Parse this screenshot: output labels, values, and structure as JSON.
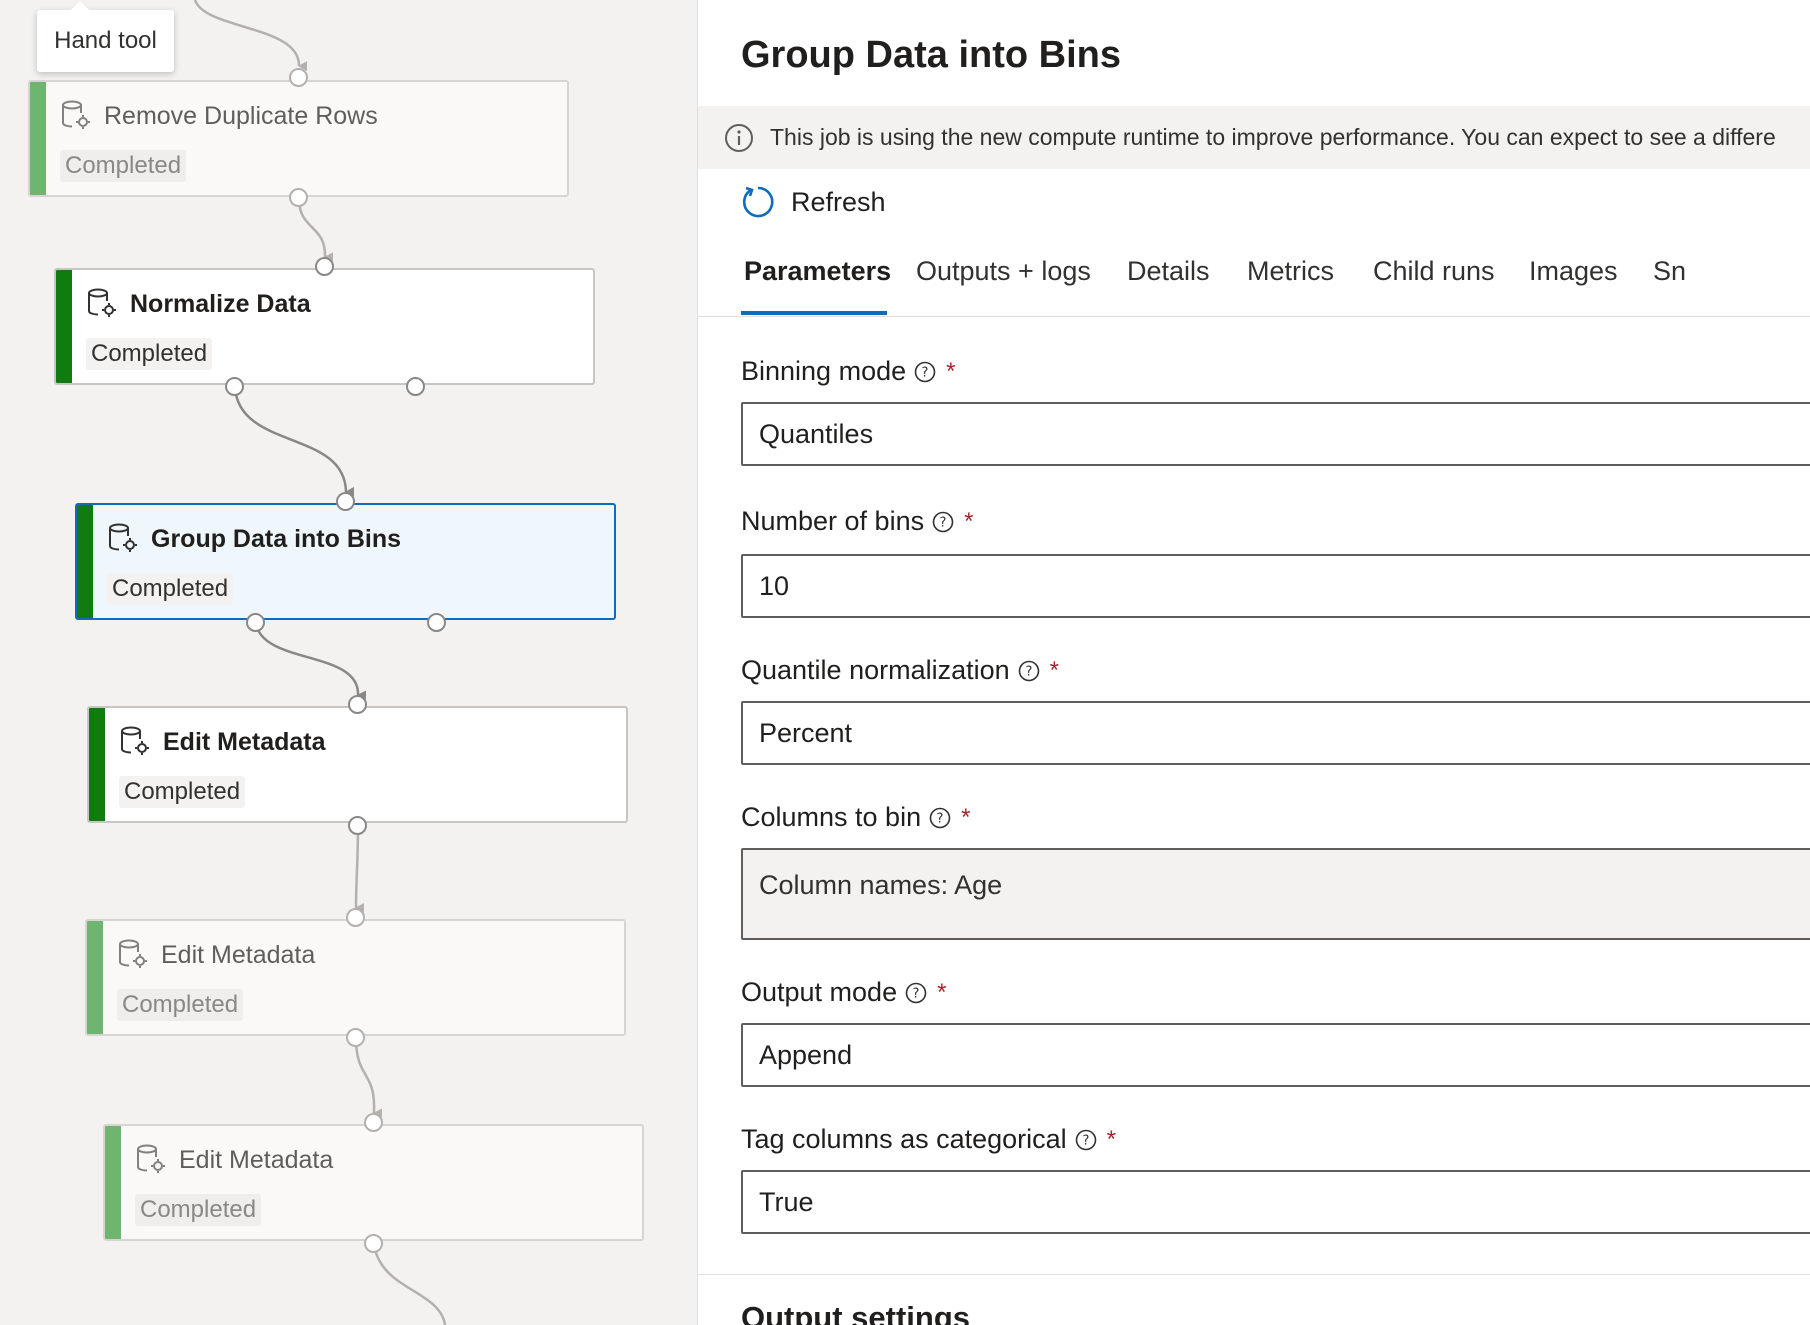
{
  "canvas": {
    "tooltip": "Hand tool",
    "nodes": [
      {
        "title": "Remove Duplicate Rows",
        "status": "Completed",
        "state": "faded"
      },
      {
        "title": "Normalize Data",
        "status": "Completed",
        "state": "normal"
      },
      {
        "title": "Group Data into Bins",
        "status": "Completed",
        "state": "selected"
      },
      {
        "title": "Edit Metadata",
        "status": "Completed",
        "state": "normal"
      },
      {
        "title": "Edit Metadata",
        "status": "Completed",
        "state": "faded"
      },
      {
        "title": "Edit Metadata",
        "status": "Completed",
        "state": "faded"
      }
    ],
    "node_icon": "database-gear-icon"
  },
  "panel": {
    "title": "Group Data into Bins",
    "banner": "This job is using the new compute runtime to improve performance. You can expect to see a differe",
    "refresh_label": "Refresh",
    "tabs": [
      "Parameters",
      "Outputs + logs",
      "Details",
      "Metrics",
      "Child runs",
      "Images",
      "Sn"
    ],
    "active_tab": "Parameters",
    "required_mark": "*",
    "fields": [
      {
        "label": "Binning mode",
        "value": "Quantiles"
      },
      {
        "label": "Number of bins",
        "value": "10"
      },
      {
        "label": "Quantile normalization",
        "value": "Percent"
      },
      {
        "label": "Columns to bin",
        "value": "Column names: Age"
      },
      {
        "label": "Output mode",
        "value": "Append"
      },
      {
        "label": "Tag columns as categorical",
        "value": "True"
      }
    ],
    "section_title": "Output settings"
  },
  "colors": {
    "accent": "#0f6cbd",
    "completed_bar": "#107c10",
    "completed_bar_faded": "#6fb46f",
    "required": "#a4262c",
    "banner_bg": "#f3f2f1"
  }
}
